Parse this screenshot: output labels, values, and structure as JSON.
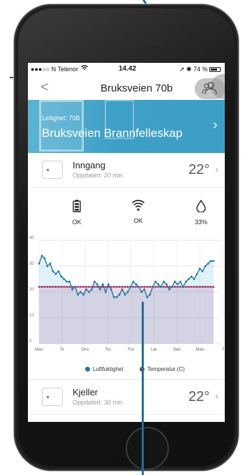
{
  "status_bar": {
    "carrier": "●●●○○ N Telenor",
    "time": "14.42",
    "battery": "74 %"
  },
  "nav": {
    "back": "<",
    "title": "Bruksveien 70b"
  },
  "banner": {
    "subtitle": "Leilighet: 70B",
    "title": "Bruksveien Brannfelleskap"
  },
  "devices": [
    {
      "name": "Inngang",
      "updated": "Oppdatert: 20 min",
      "temp": "22°"
    },
    {
      "name": "Kjeller",
      "updated": "Oppdatert: 30 min",
      "temp": "22°"
    }
  ],
  "sensors": [
    {
      "icon": "battery-icon",
      "label": "OK"
    },
    {
      "icon": "wifi-icon",
      "label": "OK"
    },
    {
      "icon": "humidity-drop-icon",
      "label": "33%"
    }
  ],
  "colors": {
    "accent": "#3d9ec6",
    "humidity_series": "#1f78a4",
    "temperature_series": "#a0366e"
  },
  "chart_data": {
    "type": "line",
    "x_labels": [
      "Man",
      "Tir",
      "Ons",
      "Tor",
      "Fre",
      "Lør",
      "Søn",
      "Man",
      "T"
    ],
    "y_ticks": [
      0,
      10,
      20,
      30,
      40
    ],
    "ylim": [
      0,
      40
    ],
    "grid": true,
    "legend_position": "bottom",
    "series": [
      {
        "name": "Luftfuktighet",
        "color": "#1f78a4",
        "values": [
          31,
          34,
          33,
          30,
          31,
          28,
          27,
          28,
          26,
          25,
          24,
          24,
          21,
          22,
          19,
          20,
          19,
          21,
          20,
          21,
          24,
          23,
          21,
          23,
          20,
          23,
          21,
          18,
          18,
          19,
          21,
          19,
          20,
          22,
          24,
          23,
          22,
          20,
          21,
          18,
          19,
          22,
          24,
          23,
          22,
          24,
          23,
          21,
          22,
          24,
          23,
          24,
          22,
          24,
          25,
          26,
          25,
          27,
          29,
          28,
          30,
          31,
          32,
          32
        ]
      },
      {
        "name": "Temperatur (C)",
        "color": "#a0366e",
        "values": [
          22,
          22,
          22,
          22,
          22,
          22,
          22,
          22,
          22,
          22,
          22,
          22,
          22,
          22,
          22,
          22,
          22,
          22,
          22,
          22,
          22,
          22,
          22,
          22,
          22,
          22,
          22,
          22,
          22,
          22,
          22,
          22,
          22,
          22,
          22,
          22,
          22,
          22,
          22,
          22,
          22,
          22,
          22,
          22,
          22,
          22,
          22,
          22,
          22,
          22,
          22,
          22,
          22,
          22,
          22,
          22,
          22,
          22,
          22,
          22,
          22,
          22,
          22,
          22
        ]
      }
    ]
  }
}
